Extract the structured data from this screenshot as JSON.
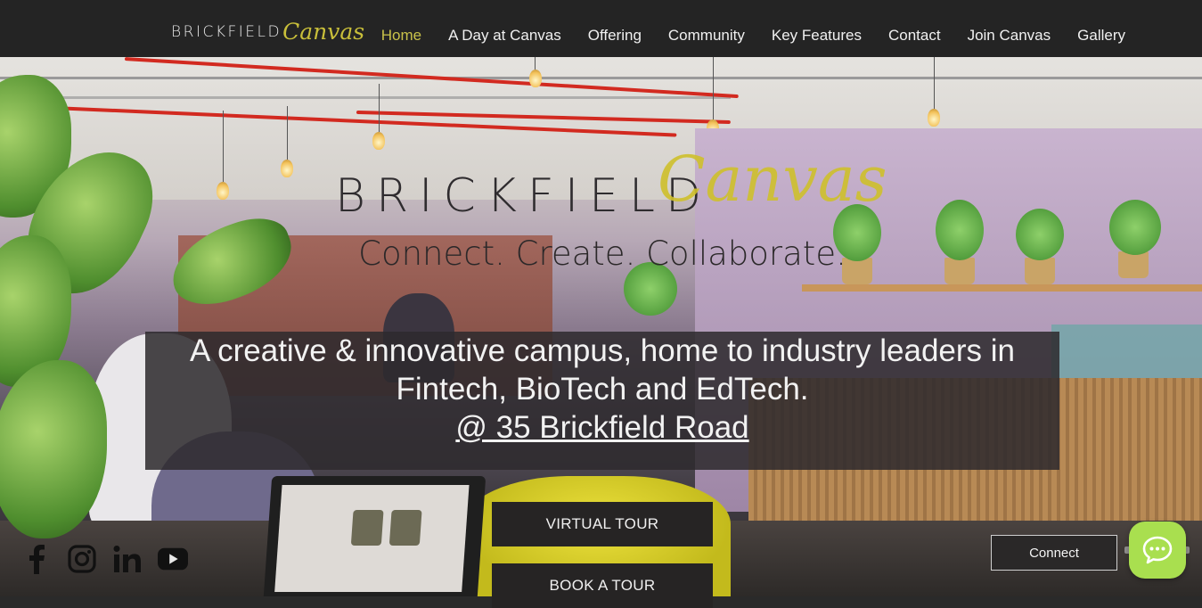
{
  "header": {
    "logo_word": "BRICKFIELD",
    "logo_script": "Canvas",
    "nav": [
      {
        "label": "Home",
        "active": true
      },
      {
        "label": "A Day at Canvas",
        "active": false
      },
      {
        "label": "Offering",
        "active": false
      },
      {
        "label": "Community",
        "active": false
      },
      {
        "label": "Key Features",
        "active": false
      },
      {
        "label": "Contact",
        "active": false
      },
      {
        "label": "Join Canvas",
        "active": false
      },
      {
        "label": "Gallery",
        "active": false
      }
    ]
  },
  "hero": {
    "brand_word": "BRICKFIELD",
    "brand_script": "Canvas",
    "tagline": "Connect. Create. Collaborate.",
    "info_line1": "A creative & innovative campus, home to industry leaders in",
    "info_line2": "Fintech, BioTech and EdTech.",
    "info_link": "@ 35 Brickfield Road",
    "virtual_tour": "VIRTUAL TOUR",
    "book_tour": "BOOK A TOUR"
  },
  "socials": [
    "facebook-icon",
    "instagram-icon",
    "linkedin-icon",
    "youtube-icon"
  ],
  "connect_label": "Connect",
  "colors": {
    "header_bg": "#242424",
    "accent": "#c9c24a",
    "chat_green": "#a9df4f"
  }
}
